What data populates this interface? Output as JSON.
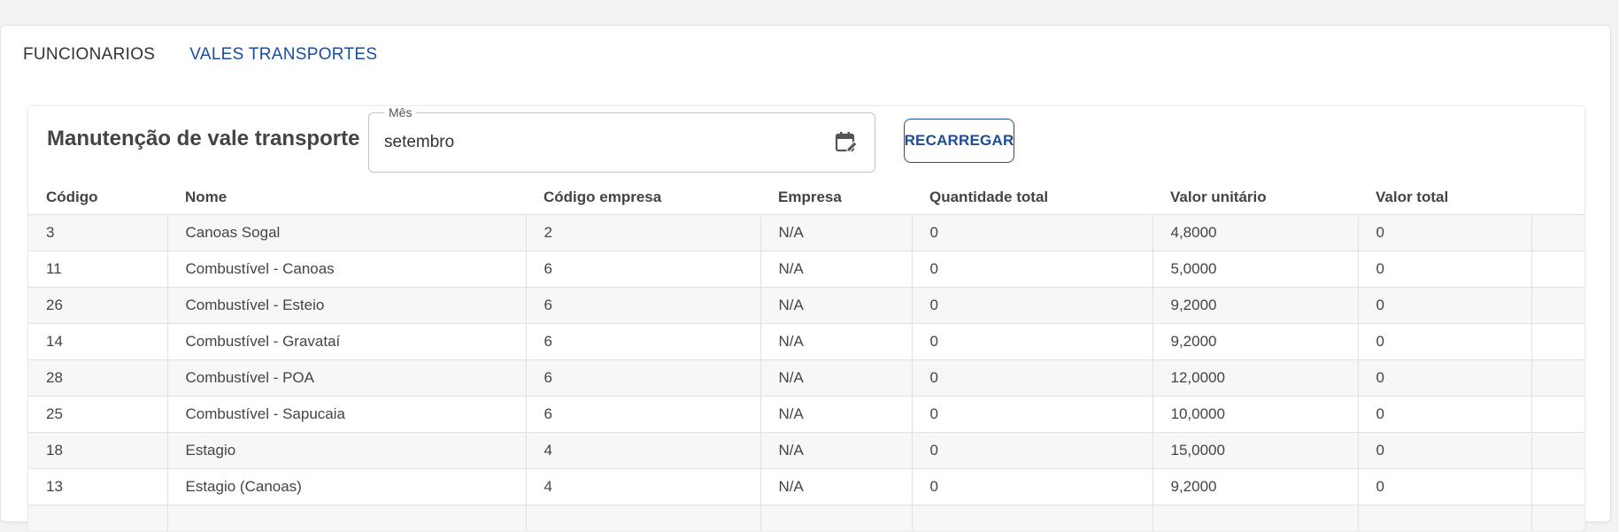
{
  "tabs": [
    {
      "label": "FUNCIONARIOS",
      "active": false
    },
    {
      "label": "VALES TRANSPORTES",
      "active": true
    }
  ],
  "panel": {
    "title": "Manutenção de vale transporte",
    "month_field": {
      "label": "Mês",
      "value": "setembro",
      "icon": "calendar-edit-icon"
    },
    "reload_label": "RECARREGAR"
  },
  "table": {
    "headers": [
      "Código",
      "Nome",
      "Código empresa",
      "Empresa",
      "Quantidade total",
      "Valor unitário",
      "Valor total",
      ""
    ],
    "rows": [
      [
        "3",
        "Canoas Sogal",
        "2",
        "N/A",
        "0",
        "4,8000",
        "0",
        ""
      ],
      [
        "11",
        "Combustível - Canoas",
        "6",
        "N/A",
        "0",
        "5,0000",
        "0",
        ""
      ],
      [
        "26",
        "Combustível - Esteio",
        "6",
        "N/A",
        "0",
        "9,2000",
        "0",
        ""
      ],
      [
        "14",
        "Combustível - Gravataí",
        "6",
        "N/A",
        "0",
        "9,2000",
        "0",
        ""
      ],
      [
        "28",
        "Combustível - POA",
        "6",
        "N/A",
        "0",
        "12,0000",
        "0",
        ""
      ],
      [
        "25",
        "Combustível - Sapucaia",
        "6",
        "N/A",
        "0",
        "10,0000",
        "0",
        ""
      ],
      [
        "18",
        "Estagio",
        "4",
        "N/A",
        "0",
        "15,0000",
        "0",
        ""
      ],
      [
        "13",
        "Estagio (Canoas)",
        "4",
        "N/A",
        "0",
        "9,2000",
        "0",
        ""
      ],
      [
        "",
        "",
        "",
        "",
        "",
        "",
        "",
        ""
      ]
    ]
  },
  "colors": {
    "accent": "#1c4c9c",
    "row_alt": "#f7f7f7",
    "border": "#e1e1e1"
  }
}
